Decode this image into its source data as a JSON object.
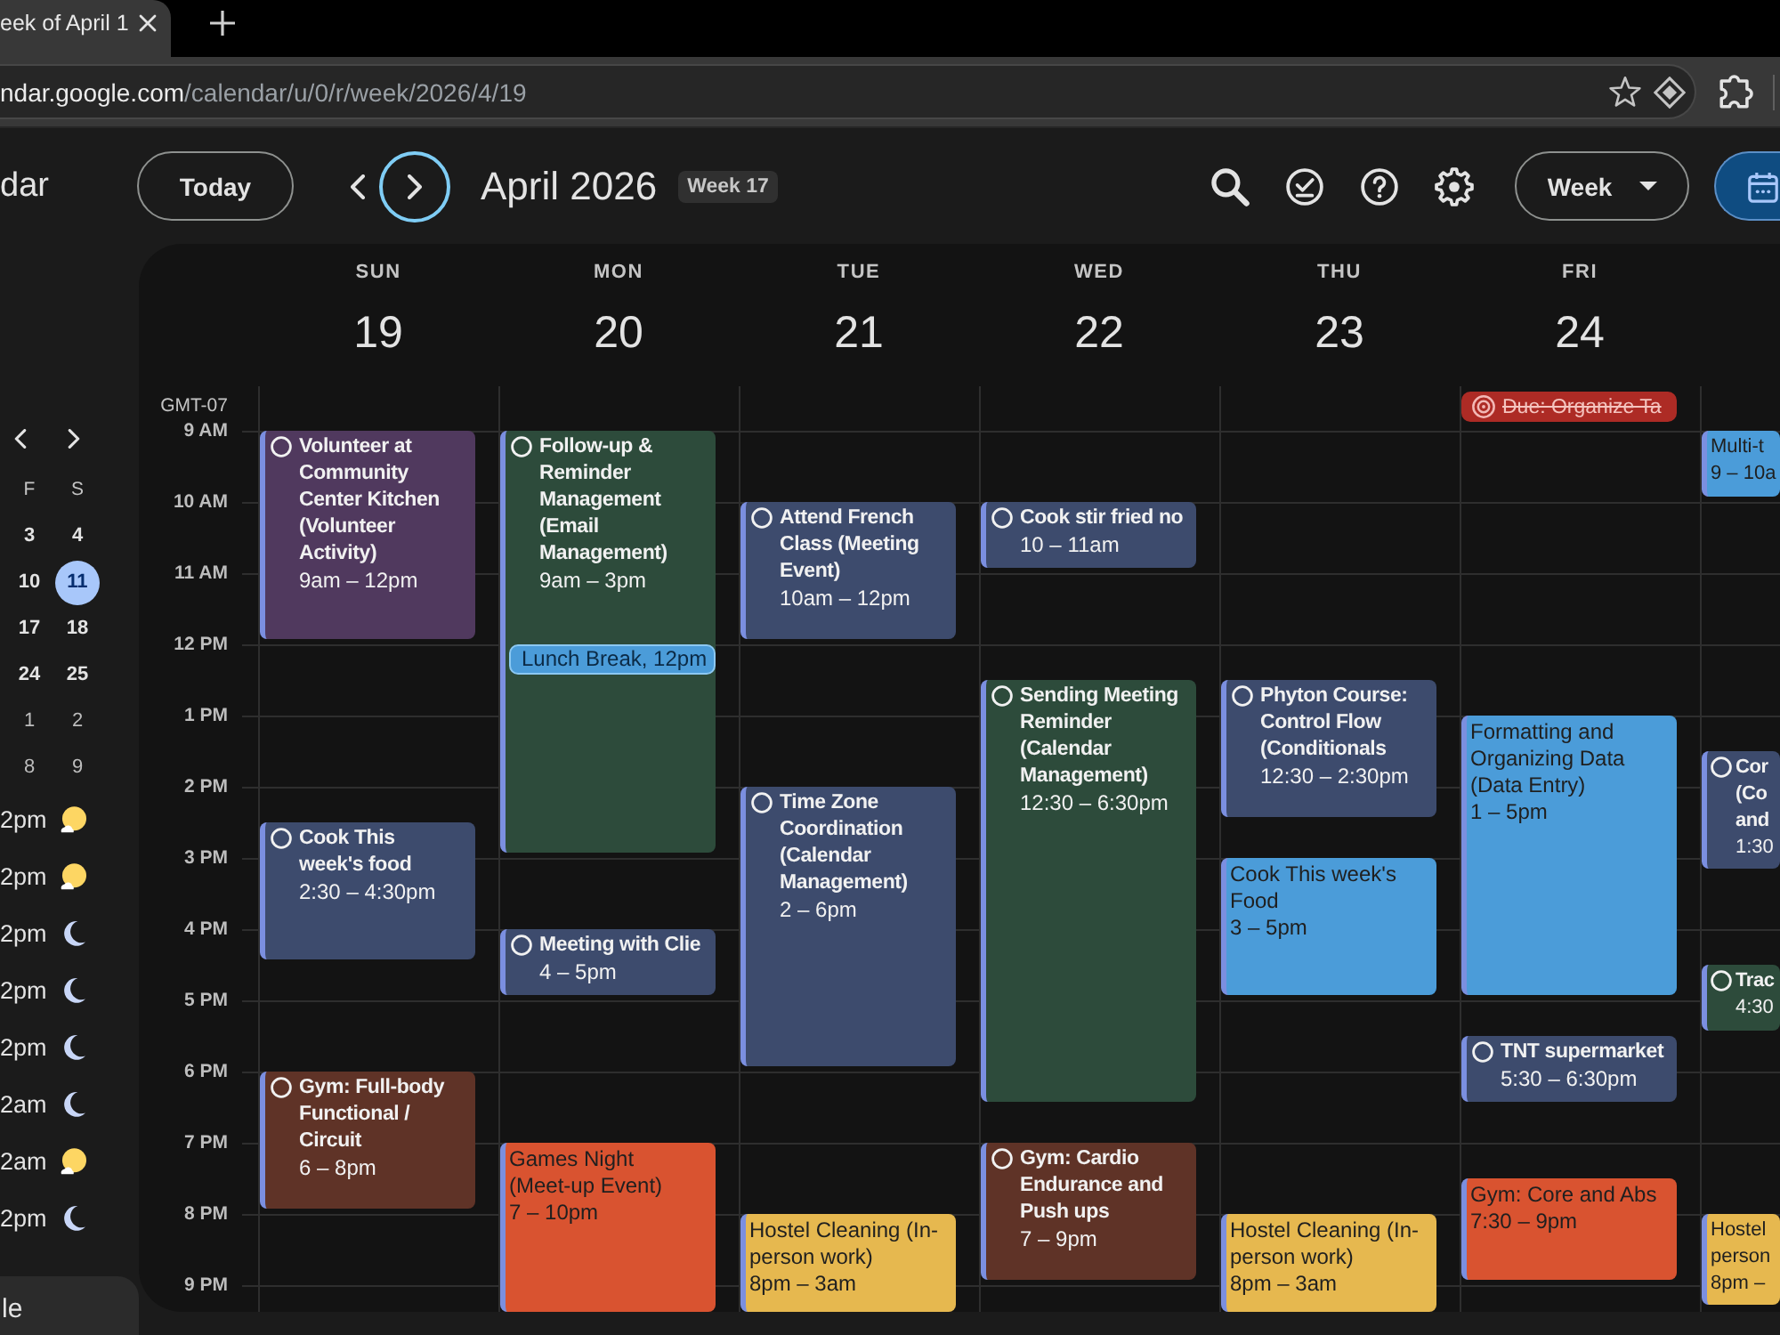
{
  "browser": {
    "tab_title": "eek of April 1",
    "url": {
      "host": "ndar.google.com",
      "path": "/calendar/u/0/r/week/2026/4/19"
    }
  },
  "header": {
    "app_title": "dar",
    "today_button": "Today",
    "next_focused": true,
    "date_range": "April 2026",
    "week_badge": "Week 17",
    "view_button": "Week"
  },
  "sidebar": {
    "mini_calendar": {
      "weekdays": [
        "F",
        "S"
      ],
      "weeks": [
        [
          {
            "label": "3",
            "today": false,
            "outside_month": false
          },
          {
            "label": "4",
            "today": false,
            "outside_month": false
          }
        ],
        [
          {
            "label": "10",
            "today": false,
            "outside_month": false
          },
          {
            "label": "11",
            "today": true,
            "outside_month": false
          }
        ],
        [
          {
            "label": "17",
            "today": false,
            "outside_month": false
          },
          {
            "label": "18",
            "today": false,
            "outside_month": false
          }
        ],
        [
          {
            "label": "24",
            "today": false,
            "outside_month": false
          },
          {
            "label": "25",
            "today": false,
            "outside_month": false
          }
        ],
        [
          {
            "label": "1",
            "today": false,
            "outside_month": true
          },
          {
            "label": "2",
            "today": false,
            "outside_month": true
          }
        ],
        [
          {
            "label": "8",
            "today": false,
            "outside_month": true
          },
          {
            "label": "9",
            "today": false,
            "outside_month": true
          }
        ]
      ]
    },
    "clocks": [
      {
        "time": "2pm",
        "daytime": true
      },
      {
        "time": "2pm",
        "daytime": true
      },
      {
        "time": "2pm",
        "daytime": false
      },
      {
        "time": "2pm",
        "daytime": false
      },
      {
        "time": "2pm",
        "daytime": false
      },
      {
        "time": "2am",
        "daytime": false
      },
      {
        "time": "2am",
        "daytime": true
      },
      {
        "time": "2pm",
        "daytime": false
      }
    ],
    "bottom_button": "le"
  },
  "calendar": {
    "timezone": "GMT-07",
    "hours": [
      "9 AM",
      "10 AM",
      "11 AM",
      "12 PM",
      "1 PM",
      "2 PM",
      "3 PM",
      "4 PM",
      "5 PM",
      "6 PM",
      "7 PM",
      "8 PM",
      "9 PM"
    ],
    "days": [
      {
        "name": "SUN",
        "number": "19",
        "events": [
          {
            "kind": "task",
            "title": "Volunteer at Community Center Kitchen (Volunteer Activity)",
            "time": "9am – 12pm",
            "color": "#50395e"
          },
          {
            "kind": "task",
            "title": "Cook This week's food",
            "time": "2:30 – 4:30pm",
            "color": "#3d4b6d"
          },
          {
            "kind": "task",
            "title": "Gym: Full-body Functional / Circuit",
            "time": "6 – 8pm",
            "color": "#5f3327"
          }
        ]
      },
      {
        "name": "MON",
        "number": "20",
        "events": [
          {
            "kind": "task",
            "title": "Follow-up & Reminder Management (Email Management)",
            "time": "9am – 3pm",
            "color": "#2d4b3b"
          },
          {
            "kind": "chip",
            "title": "Lunch Break, 12pm",
            "color": "#4b9cd9"
          },
          {
            "kind": "task",
            "title": "Meeting with Clie",
            "time": "4 – 5pm",
            "color": "#3d4b6d"
          },
          {
            "kind": "event",
            "title": "Games Night (Meet-up Event)",
            "time": "7 – 10pm",
            "color": "#d95330"
          }
        ]
      },
      {
        "name": "TUE",
        "number": "21",
        "events": [
          {
            "kind": "task",
            "title": "Attend French Class (Meeting Event)",
            "time": "10am – 12pm",
            "color": "#3d4b6d"
          },
          {
            "kind": "task",
            "title": "Time Zone Coordination (Calendar Management)",
            "time": "2 – 6pm",
            "color": "#3d4b6d"
          },
          {
            "kind": "event",
            "title": "Hostel Cleaning (In-person work)",
            "time": "8pm – 3am",
            "color": "#e6b84f"
          }
        ]
      },
      {
        "name": "WED",
        "number": "22",
        "events": [
          {
            "kind": "task",
            "title": "Cook stir fried no",
            "time": "10 – 11am",
            "color": "#3d4b6d"
          },
          {
            "kind": "task",
            "title": "Sending Meeting Reminder (Calendar Management)",
            "time": "12:30 – 6:30pm",
            "color": "#2d4b3b"
          },
          {
            "kind": "task",
            "title": "Gym: Cardio Endurance and Push ups",
            "time": "7 – 9pm",
            "color": "#5f3327"
          }
        ]
      },
      {
        "name": "THU",
        "number": "23",
        "events": [
          {
            "kind": "task",
            "title": "Phyton Course: Control Flow (Conditionals",
            "time": "12:30 – 2:30pm",
            "color": "#3d4b6d"
          },
          {
            "kind": "event",
            "title": "Cook This week's Food",
            "time": "3 – 5pm",
            "color": "#4b9cd9"
          },
          {
            "kind": "event",
            "title": "Hostel Cleaning (In-person work)",
            "time": "8pm – 3am",
            "color": "#e6b84f"
          }
        ]
      },
      {
        "name": "FRI",
        "number": "24",
        "all_day": [
          {
            "kind": "due",
            "title": "Due: Organize Ta",
            "completed": true,
            "color": "#ad2b25"
          }
        ],
        "events": [
          {
            "kind": "event",
            "title": "Formatting and Organizing Data (Data Entry)",
            "time": "1 – 5pm",
            "color": "#4b9cd9"
          },
          {
            "kind": "task",
            "title": "TNT supermarket",
            "time": "5:30 – 6:30pm",
            "color": "#3d4b6d"
          },
          {
            "kind": "event",
            "title": "Gym: Core and Abs",
            "time": "7:30 – 9pm",
            "color": "#d95330"
          }
        ]
      },
      {
        "events": [
          {
            "kind": "event",
            "title": "Multi-t",
            "time": "9 – 10a",
            "color": "#4b9cd9"
          },
          {
            "kind": "task",
            "title": "Cor (Co and",
            "time": "1:30",
            "color": "#3d4b6d"
          },
          {
            "kind": "task",
            "title": "Trac",
            "time": "4:30",
            "color": "#2d4b3b"
          },
          {
            "kind": "event",
            "title": "Hostel person",
            "time": "8pm –",
            "color": "#e6b84f"
          }
        ]
      }
    ]
  }
}
